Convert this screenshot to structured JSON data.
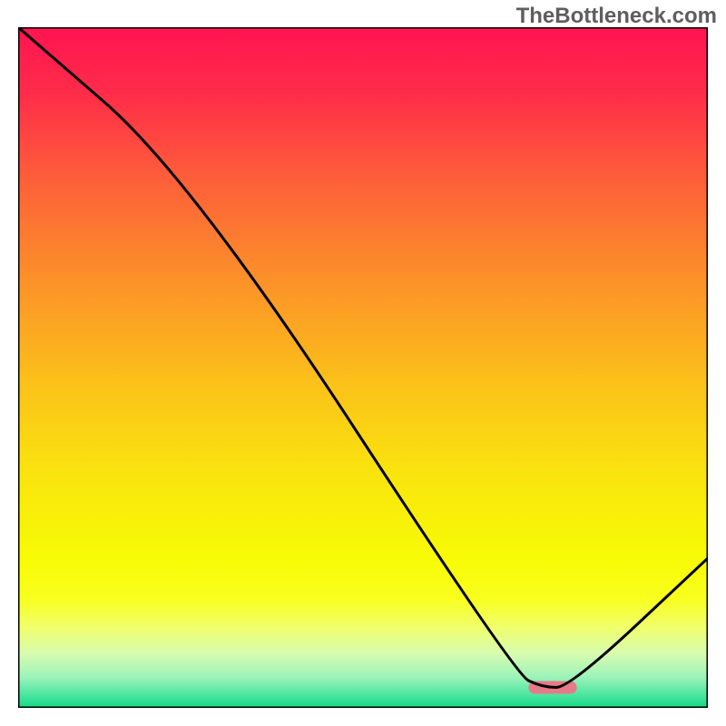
{
  "watermark": "TheBottleneck.com",
  "chart_data": {
    "type": "line",
    "title": "",
    "xlabel": "",
    "ylabel": "",
    "xlim": [
      0,
      100
    ],
    "ylim": [
      0,
      100
    ],
    "grid": false,
    "series": [
      {
        "name": "curve",
        "x": [
          0,
          25,
          72,
          76,
          80,
          100
        ],
        "values": [
          100,
          78,
          5,
          3,
          3,
          22
        ]
      }
    ],
    "marker": {
      "x_start": 74,
      "x_end": 81,
      "y": 3,
      "color": "#e77a87"
    },
    "background_gradient": {
      "direction": "vertical",
      "stops": [
        {
          "pos": 0.0,
          "color": "#ff1450"
        },
        {
          "pos": 0.1,
          "color": "#ff2d49"
        },
        {
          "pos": 0.23,
          "color": "#fd6138"
        },
        {
          "pos": 0.38,
          "color": "#fc9428"
        },
        {
          "pos": 0.52,
          "color": "#fbc01a"
        },
        {
          "pos": 0.66,
          "color": "#f9e50d"
        },
        {
          "pos": 0.78,
          "color": "#f8fb05"
        },
        {
          "pos": 0.84,
          "color": "#f8ff1e"
        },
        {
          "pos": 0.88,
          "color": "#f1ff6a"
        },
        {
          "pos": 0.92,
          "color": "#d8fcb0"
        },
        {
          "pos": 0.955,
          "color": "#9cf3ba"
        },
        {
          "pos": 0.985,
          "color": "#3fe39c"
        },
        {
          "pos": 1.0,
          "color": "#13d981"
        }
      ]
    },
    "line_color": "#000000",
    "line_width": 3,
    "frame_color": "#000000",
    "frame_width": 3
  }
}
